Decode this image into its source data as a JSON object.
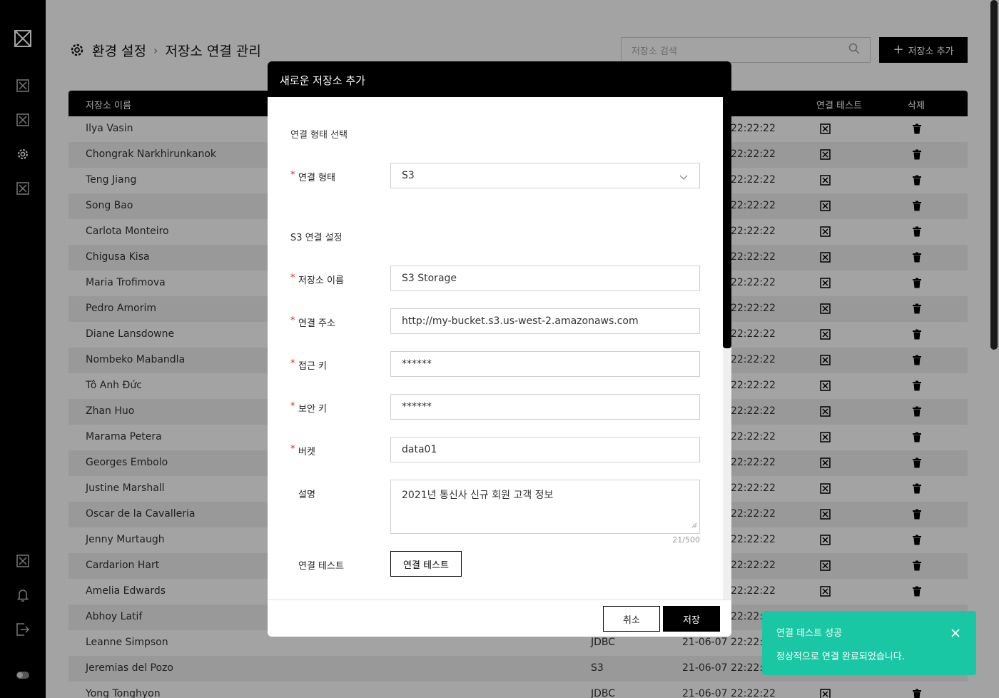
{
  "sidebar": {
    "icons": [
      "logo-icon",
      "menu-icon",
      "menu-icon",
      "gear-icon",
      "menu-icon",
      "menu-icon",
      "bell-icon",
      "logout-icon",
      "toggle-icon"
    ]
  },
  "breadcrumb": {
    "root": "환경 설정",
    "current": "저장소 연결 관리"
  },
  "search": {
    "placeholder": "저장소 검색"
  },
  "toolbar": {
    "add_label": "저장소 추가"
  },
  "table": {
    "headers": {
      "name": "저장소 이름",
      "test": "연결 테스트",
      "delete": "삭제"
    },
    "rows": [
      {
        "name": "Ilya Vasin",
        "type": "",
        "date": "21-06-07 22:22:22"
      },
      {
        "name": "Chongrak Narkhirunkanok",
        "type": "",
        "date": "21-06-07 22:22:22"
      },
      {
        "name": "Teng Jiang",
        "type": "",
        "date": "21-06-07 22:22:22"
      },
      {
        "name": "Song Bao",
        "type": "",
        "date": "21-06-07 22:22:22"
      },
      {
        "name": "Carlota Monteiro",
        "type": "",
        "date": "21-06-07 22:22:22"
      },
      {
        "name": "Chigusa Kisa",
        "type": "",
        "date": "21-06-07 22:22:22"
      },
      {
        "name": "Maria Trofimova",
        "type": "",
        "date": "21-06-07 22:22:22"
      },
      {
        "name": "Pedro Amorim",
        "type": "",
        "date": "21-06-07 22:22:22"
      },
      {
        "name": "Diane Lansdowne",
        "type": "",
        "date": "21-06-07 22:22:22"
      },
      {
        "name": "Nombeko Mabandla",
        "type": "",
        "date": "21-06-07 22:22:22"
      },
      {
        "name": "Tô Anh Đức",
        "type": "",
        "date": "21-06-07 22:22:22"
      },
      {
        "name": "Zhan Huo",
        "type": "",
        "date": "21-06-07 22:22:22"
      },
      {
        "name": "Marama Petera",
        "type": "",
        "date": "21-06-07 22:22:22"
      },
      {
        "name": "Georges Embolo",
        "type": "",
        "date": "21-06-07 22:22:22"
      },
      {
        "name": "Justine Marshall",
        "type": "",
        "date": "21-06-07 22:22:22"
      },
      {
        "name": "Oscar de la Cavalleria",
        "type": "",
        "date": "21-06-07 22:22:22"
      },
      {
        "name": "Jenny Murtaugh",
        "type": "",
        "date": "21-06-07 22:22:22"
      },
      {
        "name": "Cardarion Hart",
        "type": "",
        "date": "21-06-07 22:22:22"
      },
      {
        "name": "Amelia Edwards",
        "type": "",
        "date": "21-06-07 22:22:22"
      },
      {
        "name": "Abhoy Latif",
        "type": "",
        "date": "21-06-07 22:22:22"
      },
      {
        "name": "Leanne Simpson",
        "type": "JDBC",
        "date": "21-06-07 22:22:22"
      },
      {
        "name": "Jeremias del Pozo",
        "type": "S3",
        "date": "21-06-07 22:22:22"
      },
      {
        "name": "Yong Tonghyon",
        "type": "JDBC",
        "date": "21-06-07 22:22:22"
      }
    ]
  },
  "modal": {
    "title": "새로운 저장소 추가",
    "section_type": "연결 형태 선택",
    "type_label": "연결 형태",
    "type_value": "S3",
    "section_s3": "S3 연결 설정",
    "name_label": "저장소 이름",
    "name_value": "S3 Storage",
    "address_label": "연결 주소",
    "address_value": "http://my-bucket.s3.us-west-2.amazonaws.com",
    "access_label": "접근 키",
    "access_value": "******",
    "secret_label": "보안 키",
    "secret_value": "******",
    "bucket_label": "버켓",
    "bucket_value": "data01",
    "desc_label": "설명",
    "desc_value": "2021년 통신사 신규 회원 고객 정보",
    "desc_counter": "21/500",
    "test_label": "연결 테스트",
    "test_button": "연결 테스트",
    "cancel_button": "취소",
    "save_button": "저장"
  },
  "toast": {
    "title": "연결 테스트 성공",
    "message": "정상적으로 연결 완료되었습니다.",
    "color": "#1ac7a4"
  }
}
